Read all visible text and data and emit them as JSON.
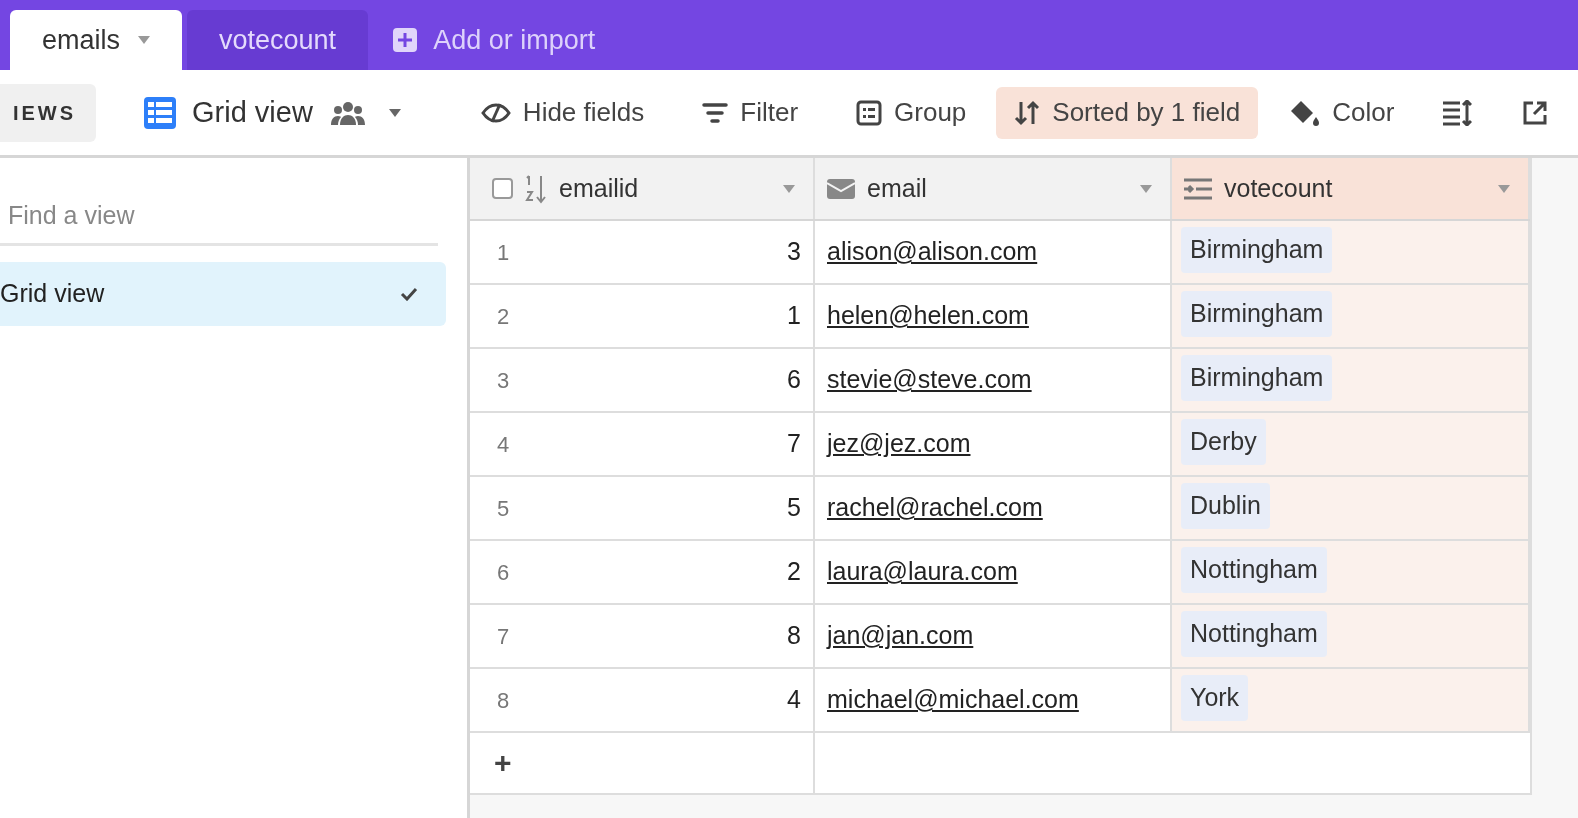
{
  "tabs": [
    {
      "label": "emails",
      "selected": true
    },
    {
      "label": "votecount",
      "selected": false
    }
  ],
  "add_tab": {
    "label": "Add or import"
  },
  "toolbar": {
    "views_label": "IEWS",
    "view_name": "Grid view",
    "buttons": [
      {
        "kind": "hide",
        "label": "Hide fields",
        "active": false
      },
      {
        "kind": "filter",
        "label": "Filter",
        "active": false
      },
      {
        "kind": "group",
        "label": "Group",
        "active": false
      },
      {
        "kind": "sort",
        "label": "Sorted by 1 field",
        "active": true
      },
      {
        "kind": "color",
        "label": "Color",
        "active": false
      }
    ]
  },
  "sidebar": {
    "search": {
      "placeholder": "Find a view"
    },
    "items": [
      {
        "label": "Grid view",
        "selected": true
      }
    ]
  },
  "table": {
    "columns": [
      {
        "kind": "number",
        "label": "emailid",
        "sorted": false
      },
      {
        "kind": "email",
        "label": "email",
        "sorted": false
      },
      {
        "kind": "lookup",
        "label": "votecount",
        "sorted": true
      }
    ],
    "rows": [
      {
        "number": "1",
        "emailid": "3",
        "email": "alison@alison.com",
        "votecount": "Birmingham"
      },
      {
        "number": "2",
        "emailid": "1",
        "email": "helen@helen.com",
        "votecount": "Birmingham"
      },
      {
        "number": "3",
        "emailid": "6",
        "email": "stevie@steve.com",
        "votecount": "Birmingham"
      },
      {
        "number": "4",
        "emailid": "7",
        "email": "jez@jez.com",
        "votecount": "Derby"
      },
      {
        "number": "5",
        "emailid": "5",
        "email": "rachel@rachel.com",
        "votecount": "Dublin"
      },
      {
        "number": "6",
        "emailid": "2",
        "email": "laura@laura.com",
        "votecount": "Nottingham"
      },
      {
        "number": "7",
        "emailid": "8",
        "email": "jan@jan.com",
        "votecount": "Nottingham"
      },
      {
        "number": "8",
        "emailid": "4",
        "email": "michael@michael.com",
        "votecount": "York"
      }
    ],
    "add_row": "+"
  }
}
